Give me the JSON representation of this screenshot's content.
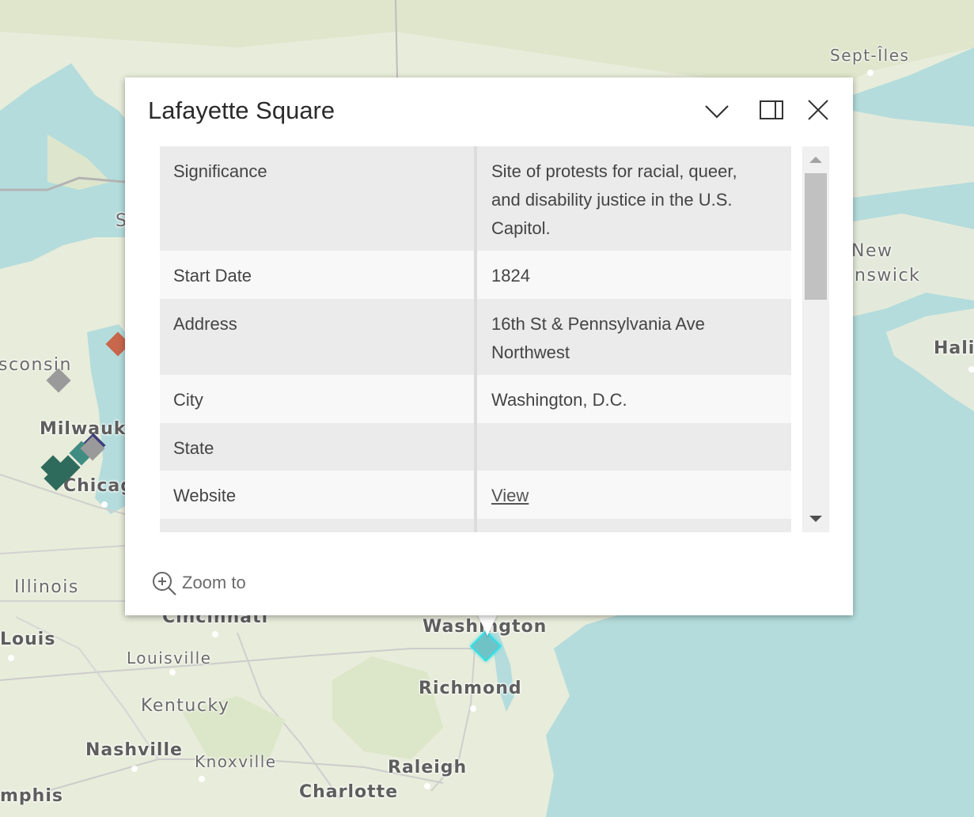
{
  "map": {
    "labels": {
      "sept_iles": "Sept-Îles",
      "new_brunswick_1": "New",
      "new_brunswick_2": "nswick",
      "halifax": "Hali",
      "wisconsin": "sconsin",
      "milwaukee": "Milwauk",
      "chicago": "Chicag",
      "illinois": "Illinois",
      "st_louis": "Louis",
      "cincinnati": "Cincinnati",
      "louisville": "Louisville",
      "kentucky": "Kentucky",
      "washington": "Washington",
      "richmond": "Richmond",
      "nashville": "Nashville",
      "knoxville": "Knoxville",
      "raleigh": "Raleigh",
      "memphis": "mphis",
      "charlotte": "Charlotte",
      "s_fragment": "S"
    },
    "marker_colors": {
      "orange": "#c9674d",
      "gray": "#9a9a9a",
      "dark_green": "#2f6b5c",
      "teal": "#3f8c82",
      "navy": "#3c3f7a",
      "selected": "#6fc3c7"
    }
  },
  "popup": {
    "title": "Lafayette Square",
    "collapse_icon": "chevron-down-icon",
    "dock_icon": "dock-side-icon",
    "close_icon": "close-icon",
    "fields": [
      {
        "key": "Significance",
        "value_lines": [
          "Site of protests for racial, queer,",
          "and disability justice in the U.S.",
          "Capitol."
        ]
      },
      {
        "key": "Start Date",
        "value_lines": [
          "1824"
        ]
      },
      {
        "key": "Address",
        "value_lines": [
          "16th St & Pennsylvania Ave",
          "Northwest"
        ]
      },
      {
        "key": "City",
        "value_lines": [
          "Washington, D.C."
        ]
      },
      {
        "key": "State",
        "value_lines": [
          ""
        ]
      },
      {
        "key": "Website",
        "value_lines": [
          "View"
        ],
        "is_link": true
      }
    ],
    "zoom_to_label": "Zoom to",
    "zoom_icon": "zoom-in-icon"
  }
}
